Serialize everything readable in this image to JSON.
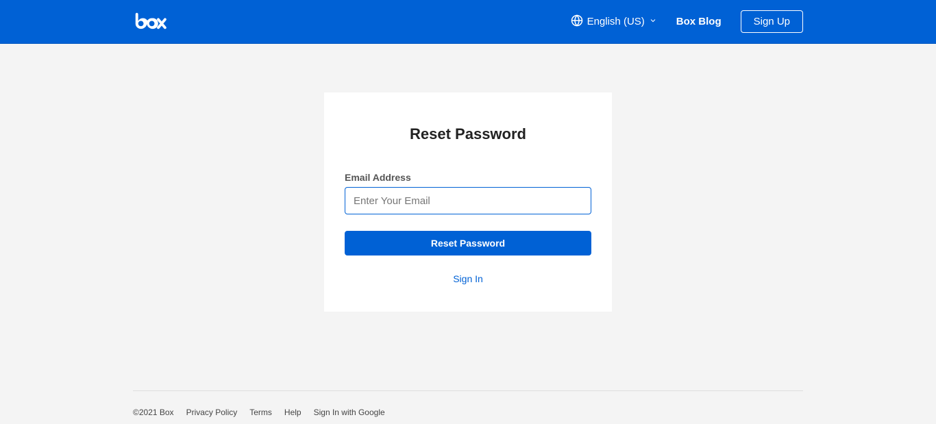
{
  "header": {
    "language": "English (US)",
    "blog_label": "Box Blog",
    "signup_label": "Sign Up"
  },
  "card": {
    "title": "Reset Password",
    "email_label": "Email Address",
    "email_placeholder": "Enter Your Email",
    "reset_button": "Reset Password",
    "signin_link": "Sign In"
  },
  "footer": {
    "copyright": "©2021 Box",
    "privacy": "Privacy Policy",
    "terms": "Terms",
    "help": "Help",
    "google_signin": "Sign In with Google"
  }
}
